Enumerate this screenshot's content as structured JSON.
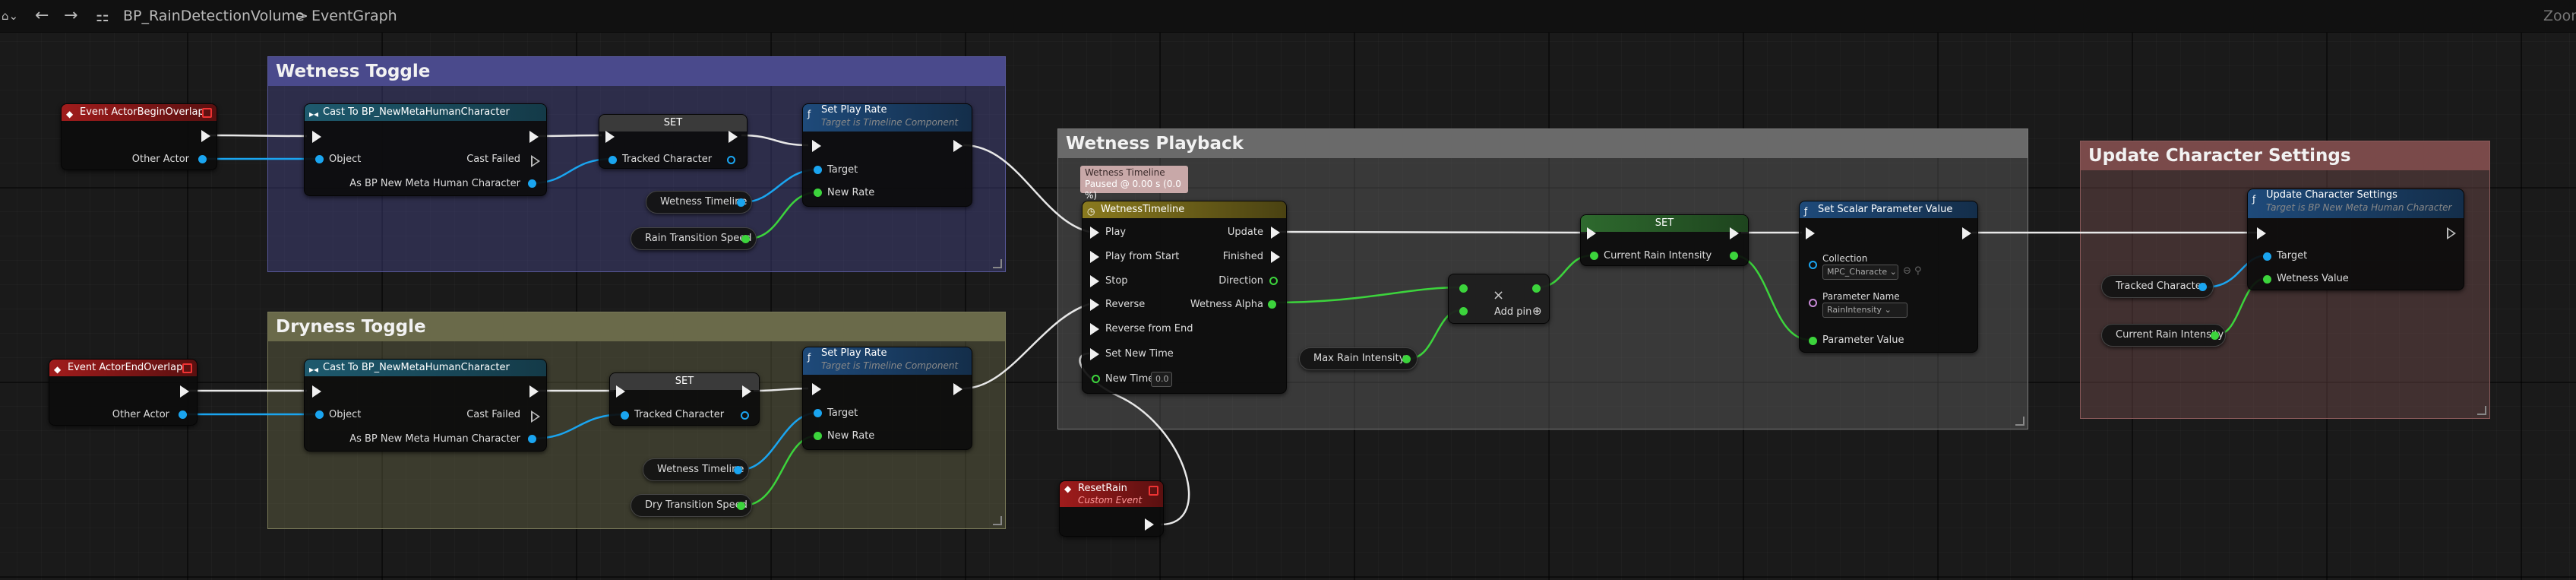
{
  "toolbar": {
    "breadcrumb_blueprint": "BP_RainDetectionVolume",
    "breadcrumb_separator": ">",
    "breadcrumb_graph": "EventGraph",
    "zoom_label": "Zoom",
    "icons": [
      "back-arrow-icon",
      "forward-arrow-icon",
      "blueprint-graph-icon",
      "chevron-right-icon"
    ]
  },
  "comments": {
    "wetness_toggle": "Wetness Toggle",
    "dryness_toggle": "Dryness Toggle",
    "wetness_playback": "Wetness Playback",
    "update_character_settings": "Update Character Settings"
  },
  "nodes": {
    "event_begin": {
      "title": "Event ActorBeginOverlap",
      "pin_other_actor": "Other Actor"
    },
    "event_end": {
      "title": "Event ActorEndOverlap",
      "pin_other_actor": "Other Actor"
    },
    "cast1": {
      "title": "Cast To BP_NewMetaHumanCharacter",
      "pin_object": "Object",
      "pin_cast_failed": "Cast Failed",
      "pin_as": "As BP New Meta Human Character"
    },
    "cast2": {
      "title": "Cast To BP_NewMetaHumanCharacter",
      "pin_object": "Object",
      "pin_cast_failed": "Cast Failed",
      "pin_as": "As BP New Meta Human Character"
    },
    "set1": {
      "title": "SET",
      "pin": "Tracked Character"
    },
    "set2": {
      "title": "SET",
      "pin": "Tracked Character"
    },
    "playrate1": {
      "title": "Set Play Rate",
      "subtitle": "Target is Timeline Component",
      "pin_target": "Target",
      "pin_newrate": "New Rate"
    },
    "playrate2": {
      "title": "Set Play Rate",
      "subtitle": "Target is Timeline Component",
      "pin_target": "Target",
      "pin_newrate": "New Rate"
    },
    "wetness_timeline_get1": "Wetness Timeline",
    "wetness_timeline_get2": "Wetness Timeline",
    "rain_transition_speed": "Rain Transition Speed",
    "dry_transition_speed": "Dry Transition Speed",
    "timeline_preview": {
      "title": "Wetness Timeline",
      "status": "Paused @ 0.00 s (0.0 %)"
    },
    "timeline": {
      "title": "WetnessTimeline",
      "inputs": [
        "Play",
        "Play from Start",
        "Stop",
        "Reverse",
        "Reverse from End",
        "Set New Time",
        "New Time"
      ],
      "outputs": [
        "Update",
        "Finished",
        "Direction",
        "Wetness Alpha"
      ],
      "new_time_value": "0.0"
    },
    "max_rain_intensity": "Max Rain Intensity",
    "add": {
      "symbol": "×",
      "add_pin": "Add pin",
      "add_pin_symbol": "⊕"
    },
    "set3": {
      "title": "SET",
      "pin": "Current Rain Intensity"
    },
    "scalar": {
      "title": "Set Scalar Parameter Value",
      "collection_label": "Collection",
      "collection_value": "MPC_Characte",
      "param_name_label": "Parameter Name",
      "param_name_value": "RainIntensity",
      "param_value_label": "Parameter Value"
    },
    "reset_rain": {
      "title": "ResetRain",
      "subtitle": "Custom Event"
    },
    "update_char": {
      "title": "Update Character Settings",
      "subtitle": "Target is BP New Meta Human Character",
      "pin_target": "Target",
      "pin_wetness": "Wetness Value"
    },
    "tracked_character_get": "Tracked Character",
    "current_rain_intensity_get": "Current Rain Intensity"
  },
  "colors": {
    "exec": "#f0f0f0",
    "object_pin": "#1aa5f0",
    "float_pin": "#3cd43c",
    "event_header": "#a01c1c",
    "cast_header": "#1e5a6e",
    "function_header": "#1e4a7a",
    "timeline_header": "#8a7a1e",
    "set_header": "#3a3a3a",
    "set_green_header": "#2e6a2e",
    "wetness_toggle_comment": "#4a4a8c",
    "dryness_toggle_comment": "#6a6a4a",
    "wetness_playback_comment": "#6a6a6a",
    "update_character_comment": "#7a4a4a"
  }
}
